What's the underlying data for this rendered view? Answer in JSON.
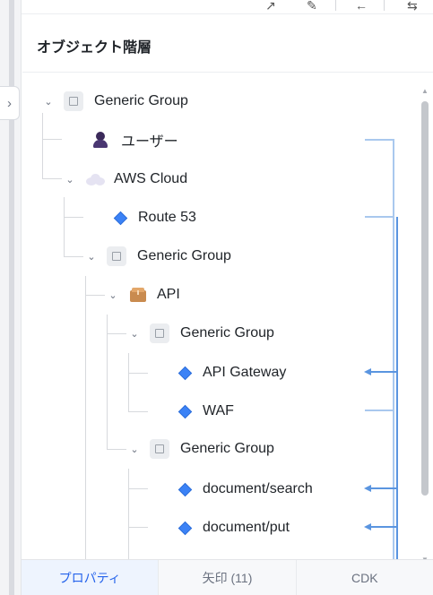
{
  "panel": {
    "title": "オブジェクト階層"
  },
  "tree": {
    "items": [
      {
        "label": "Generic Group",
        "icon": "group-icon"
      },
      {
        "label": "ユーザー",
        "icon": "user-icon"
      },
      {
        "label": "AWS Cloud",
        "icon": "cloud-icon"
      },
      {
        "label": "Route 53",
        "icon": "diamond-icon"
      },
      {
        "label": "Generic Group",
        "icon": "group-icon"
      },
      {
        "label": "API",
        "icon": "package-icon"
      },
      {
        "label": "Generic Group",
        "icon": "group-icon"
      },
      {
        "label": "API Gateway",
        "icon": "diamond-icon"
      },
      {
        "label": "WAF",
        "icon": "diamond-icon"
      },
      {
        "label": "Generic Group",
        "icon": "group-icon"
      },
      {
        "label": "document/search",
        "icon": "diamond-icon"
      },
      {
        "label": "document/put",
        "icon": "diamond-icon"
      }
    ]
  },
  "tabs": [
    {
      "label": "プロパティ",
      "active": true
    },
    {
      "label": "矢印 (11)",
      "active": false
    },
    {
      "label": "CDK",
      "active": false
    }
  ],
  "colors": {
    "accent": "#2563eb",
    "node": "#3b82f6",
    "arrow": "#7fb0ec"
  }
}
